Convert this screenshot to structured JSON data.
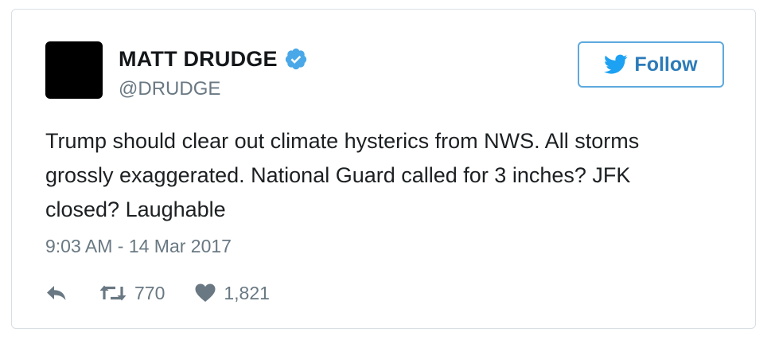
{
  "user": {
    "display_name": "MATT DRUDGE",
    "handle": "@DRUDGE",
    "verified": true
  },
  "follow_button": {
    "label": "Follow",
    "icon": "twitter-bird-icon"
  },
  "tweet": {
    "text": "Trump should clear out climate hysterics from NWS. All storms grossly exaggerated. National Guard called for 3 inches? JFK closed? Laughable",
    "timestamp": "9:03 AM - 14 Mar 2017"
  },
  "actions": {
    "reply": {
      "icon": "reply-icon"
    },
    "retweet": {
      "icon": "retweet-icon",
      "count": "770"
    },
    "like": {
      "icon": "heart-icon",
      "count": "1,821"
    }
  },
  "colors": {
    "accent": "#2b7bb9",
    "button_border": "#5ea9dd",
    "verified": "#4aa8e8",
    "muted": "#697882",
    "text": "#1c2022"
  }
}
